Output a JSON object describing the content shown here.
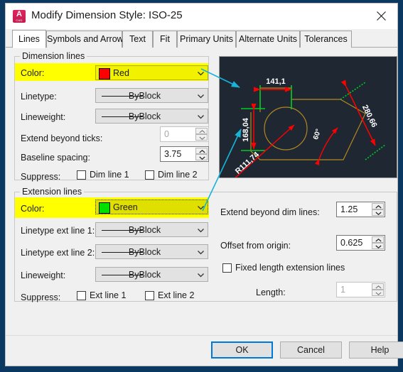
{
  "window": {
    "title": "Modify Dimension Style: ISO-25",
    "app_icon": "autocad-a-icon",
    "close_icon": "close-icon"
  },
  "tabs": [
    {
      "label": "Lines",
      "active": true
    },
    {
      "label": "Symbols and Arrows",
      "active": false
    },
    {
      "label": "Text",
      "active": false
    },
    {
      "label": "Fit",
      "active": false
    },
    {
      "label": "Primary Units",
      "active": false
    },
    {
      "label": "Alternate Units",
      "active": false
    },
    {
      "label": "Tolerances",
      "active": false
    }
  ],
  "dimension_lines": {
    "group_label": "Dimension lines",
    "color": {
      "label": "Color:",
      "value": "Red",
      "swatch": "#ff0000",
      "highlighted": true
    },
    "linetype": {
      "label": "Linetype:",
      "value": "ByBlock"
    },
    "lineweight": {
      "label": "Lineweight:",
      "value": "ByBlock"
    },
    "extend_beyond_ticks": {
      "label": "Extend beyond ticks:",
      "value": "0",
      "disabled": true
    },
    "baseline_spacing": {
      "label": "Baseline spacing:",
      "value": "3.75",
      "disabled": false
    },
    "suppress": {
      "label": "Suppress:",
      "items": [
        {
          "label": "Dim line 1",
          "checked": false
        },
        {
          "label": "Dim line 2",
          "checked": false
        }
      ]
    }
  },
  "extension_lines": {
    "group_label": "Extension lines",
    "color": {
      "label": "Color:",
      "value": "Green",
      "swatch": "#00e000",
      "highlighted": true,
      "focused": true
    },
    "linetype_ext1": {
      "label": "Linetype ext line 1:",
      "value": "ByBlock"
    },
    "linetype_ext2": {
      "label": "Linetype ext line 2:",
      "value": "ByBlock"
    },
    "lineweight": {
      "label": "Lineweight:",
      "value": "ByBlock"
    },
    "suppress": {
      "label": "Suppress:",
      "items": [
        {
          "label": "Ext line 1",
          "checked": false
        },
        {
          "label": "Ext line 2",
          "checked": false
        }
      ]
    },
    "extend_beyond_dim_lines": {
      "label": "Extend beyond dim lines:",
      "value": "1.25",
      "disabled": false
    },
    "offset_from_origin": {
      "label": "Offset from origin:",
      "value": "0.625",
      "disabled": false
    },
    "fixed_length": {
      "label": "Fixed length extension lines",
      "checked": false
    },
    "length": {
      "label": "Length:",
      "value": "1",
      "disabled": true
    }
  },
  "preview": {
    "name": "dimension-style-preview",
    "background": "#1f2733",
    "dim_color": "#ff0000",
    "ext_color": "#00cc22",
    "geometry_color": "#b3881f",
    "text_color": "#ffffff",
    "labels": {
      "horizontal": "141,1",
      "vertical": "168,04",
      "diagonal": "280,66",
      "radius": "R111,74",
      "angle": "60°"
    }
  },
  "callouts": {
    "color": "#16b4d8",
    "arrow1_name": "callout-arrow-dimension-color",
    "arrow2_name": "callout-arrow-extension-color"
  },
  "footer": {
    "ok": "OK",
    "cancel": "Cancel",
    "help": "Help"
  }
}
